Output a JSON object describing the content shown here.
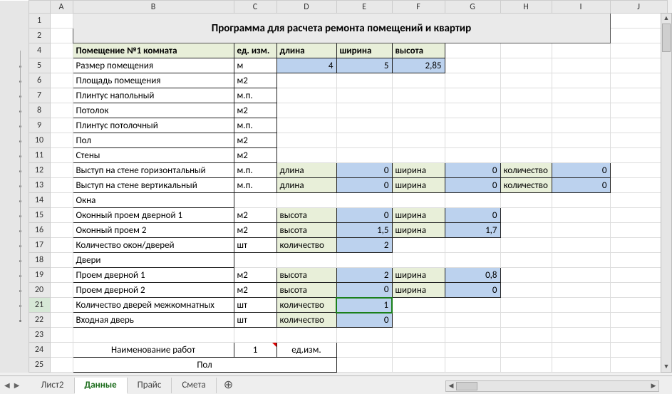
{
  "outline_levels": [
    "1",
    "2"
  ],
  "columns": [
    "A",
    "B",
    "C",
    "D",
    "E",
    "F",
    "G",
    "H",
    "I",
    "J"
  ],
  "title": "Программа для расчета ремонта помещений и квартир",
  "header": {
    "room": "Помещение №1 комната",
    "unit": "ед. изм.",
    "length": "длина",
    "width": "ширина",
    "height": "высота"
  },
  "rows": {
    "r5": {
      "no": "5",
      "label": "Размер помещения",
      "unit": "м",
      "length": "4",
      "width": "5",
      "height": "2,85"
    },
    "r6": {
      "no": "6",
      "label": "Площадь помещения",
      "unit": "м2"
    },
    "r7": {
      "no": "7",
      "label": "Плинтус напольный",
      "unit": "м.п."
    },
    "r8": {
      "no": "8",
      "label": "Потолок",
      "unit": "м2"
    },
    "r9": {
      "no": "9",
      "label": "Плинтус потолочный",
      "unit": "м.п."
    },
    "r10": {
      "no": "10",
      "label": "Пол",
      "unit": "м2"
    },
    "r11": {
      "no": "11",
      "label": "Стены",
      "unit": "м2"
    },
    "r12": {
      "no": "12",
      "label": "Выступ на стене горизонтальный",
      "unit": "м.п.",
      "p1": "длина",
      "v1": "0",
      "p2": "ширина",
      "v2": "0",
      "p3": "количество",
      "v3": "0"
    },
    "r13": {
      "no": "13",
      "label": "Выступ на стене вертикальный",
      "unit": "м.п.",
      "p1": "длина",
      "v1": "0",
      "p2": "ширина",
      "v2": "0",
      "p3": "количество",
      "v3": "0"
    },
    "r14": {
      "no": "14",
      "label": "Окна"
    },
    "r15": {
      "no": "15",
      "label": "Оконный проем дверной 1",
      "unit": "м2",
      "p1": "высота",
      "v1": "0",
      "p2": "ширина",
      "v2": "0"
    },
    "r16": {
      "no": "16",
      "label": "Оконный проем 2",
      "unit": "м2",
      "p1": "высота",
      "v1": "1,5",
      "p2": "ширина",
      "v2": "1,7"
    },
    "r17": {
      "no": "17",
      "label": "Количество окон/дверей",
      "unit": "шт",
      "p1": "количество",
      "v1": "2"
    },
    "r18": {
      "no": "18",
      "label": "Двери"
    },
    "r19": {
      "no": "19",
      "label": "Проем дверной 1",
      "unit": "м2",
      "p1": "высота",
      "v1": "2",
      "p2": "ширина",
      "v2": "0,8"
    },
    "r20": {
      "no": "20",
      "label": "Проем дверной 2",
      "unit": "м2",
      "p1": "высота",
      "v1": "0",
      "p2": "ширина",
      "v2": "0"
    },
    "r21": {
      "no": "21",
      "label": "Количество дверей межкомнатных",
      "unit": "шт",
      "p1": "количество",
      "v1": "1"
    },
    "r22": {
      "no": "22",
      "label": "Входная дверь",
      "unit": "шт",
      "p1": "количество",
      "v1": "0"
    }
  },
  "row_numbers_simple": {
    "r1": "1",
    "r2": "2",
    "r4": "4",
    "r23": "23",
    "r24": "24",
    "r25": "25"
  },
  "works": {
    "name_header": "Наименование работ",
    "col1": "1",
    "unit": "ед.изм.",
    "section": "Пол"
  },
  "tabs": [
    "Лист2",
    "Данные",
    "Прайс",
    "Смета"
  ],
  "active_tab": 1
}
